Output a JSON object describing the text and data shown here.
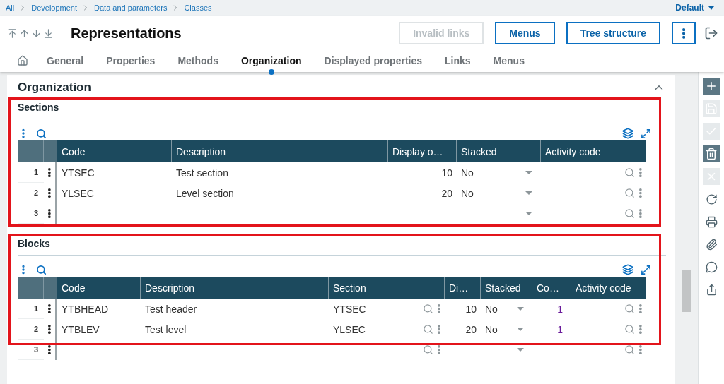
{
  "breadcrumb": [
    "All",
    "Development",
    "Data and parameters",
    "Classes"
  ],
  "profile": {
    "label": "Default"
  },
  "title": "Representations",
  "buttons": [
    {
      "label": "Invalid links",
      "disabled": true
    },
    {
      "label": "Menus",
      "disabled": false
    },
    {
      "label": "Tree structure",
      "disabled": false
    }
  ],
  "tabs": [
    {
      "label": "General",
      "selected": false
    },
    {
      "label": "Properties",
      "selected": false
    },
    {
      "label": "Methods",
      "selected": false
    },
    {
      "label": "Organization",
      "selected": true
    },
    {
      "label": "Displayed properties",
      "selected": false
    },
    {
      "label": "Links",
      "selected": false
    },
    {
      "label": "Menus",
      "selected": false
    }
  ],
  "card": {
    "title": "Organization",
    "expanded": true
  },
  "sections": [
    {
      "title": "Sections",
      "highlighted": true,
      "columns": [
        {
          "label": "Code",
          "kind": "text"
        },
        {
          "label": "Description",
          "kind": "text"
        },
        {
          "label": "Display o…",
          "kind": "number"
        },
        {
          "label": "Stacked",
          "kind": "select"
        },
        {
          "label": "Activity code",
          "kind": "lookup"
        }
      ],
      "rows": [
        {
          "number": "1",
          "cells": [
            "YTSEC",
            "Test section",
            "10",
            "No",
            null
          ]
        },
        {
          "number": "2",
          "cells": [
            "YLSEC",
            "Level section",
            "20",
            "No",
            null
          ]
        },
        {
          "number": "3"
        }
      ]
    },
    {
      "title": "Blocks",
      "highlighted": true,
      "columns": [
        {
          "label": "Code",
          "kind": "text"
        },
        {
          "label": "Description",
          "kind": "text"
        },
        {
          "label": "Section",
          "kind": "lookup"
        },
        {
          "label": "Di…",
          "kind": "number"
        },
        {
          "label": "Stacked",
          "kind": "select"
        },
        {
          "label": "Co…",
          "kind": "link"
        },
        {
          "label": "Activity code",
          "kind": "lookup"
        }
      ],
      "rows": [
        {
          "number": "1",
          "cells": [
            "YTBHEAD",
            "Test header",
            "YTSEC",
            "10",
            "No",
            "1",
            null
          ]
        },
        {
          "number": "2",
          "cells": [
            "YTBLEV",
            "Test level",
            "YLSEC",
            "20",
            "No",
            "1",
            null
          ]
        },
        {
          "number": "3"
        }
      ]
    }
  ],
  "side_toolbar": [
    {
      "kind": "add",
      "disabled": false
    },
    {
      "kind": "save",
      "disabled": true
    },
    {
      "kind": "check",
      "disabled": true
    },
    {
      "kind": "delete",
      "disabled": false
    },
    {
      "kind": "close",
      "disabled": true
    },
    {
      "kind": "refresh",
      "disabled": false
    },
    {
      "kind": "print",
      "disabled": false
    },
    {
      "kind": "attach",
      "disabled": false
    },
    {
      "kind": "comment",
      "disabled": false
    },
    {
      "kind": "share",
      "disabled": false
    }
  ]
}
